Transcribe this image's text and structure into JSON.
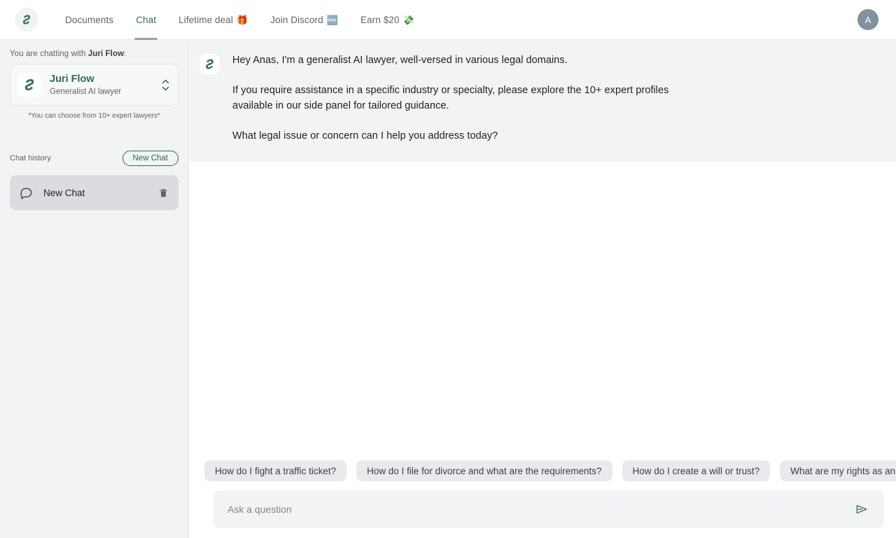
{
  "brand": {
    "logo_icon": "juri-swirl-logo"
  },
  "topnav": {
    "items": [
      {
        "label": "Documents",
        "emoji": "",
        "active": false
      },
      {
        "label": "Chat",
        "emoji": "",
        "active": true
      },
      {
        "label": "Lifetime deal",
        "emoji": "🎁",
        "active": false
      },
      {
        "label": "Join Discord",
        "emoji": "🆕",
        "active": false
      },
      {
        "label": "Earn $20",
        "emoji": "💸",
        "active": false
      }
    ],
    "avatar_initial": "A"
  },
  "sidebar": {
    "chatting_with_prefix": "You are chatting with ",
    "chatting_with_name": "Juri Flow",
    "chatting_with_suffix": ":",
    "model": {
      "name": "Juri Flow",
      "role": "Generalist AI lawyer",
      "avatar_icon": "juri-swirl-logo",
      "selector_icon": "chevron-up-down-icon"
    },
    "hint": "*You can choose from 10+ expert lawyers*",
    "history_label": "Chat history",
    "new_chat_label": "New Chat",
    "history": [
      {
        "title": "New Chat",
        "icon": "chat-bubble-icon",
        "delete_icon": "trash-icon"
      }
    ]
  },
  "conversation": {
    "messages": [
      {
        "author_avatar_icon": "juri-swirl-logo",
        "paragraphs": [
          "Hey Anas, I'm a generalist AI lawyer, well-versed in various legal domains.",
          "If you require assistance in a specific industry or specialty, please explore the 10+ expert profiles available in our side panel for tailored guidance.",
          "What legal issue or concern can I help you address today?"
        ]
      }
    ]
  },
  "composer": {
    "suggestions": [
      "How do I fight a traffic ticket?",
      "How do I file for divorce and what are the requirements?",
      "How do I create a will or trust?",
      "What are my rights as an employee?"
    ],
    "input_value": "",
    "input_placeholder": "Ask a question",
    "send_icon": "send-paper-plane-icon"
  },
  "colors": {
    "brand_green": "#2f6b5e",
    "surface_gray": "#f1f3f4",
    "chip_gray": "#e8eaed",
    "history_active": "#dadce0",
    "avatar_bg": "#7f929e"
  }
}
